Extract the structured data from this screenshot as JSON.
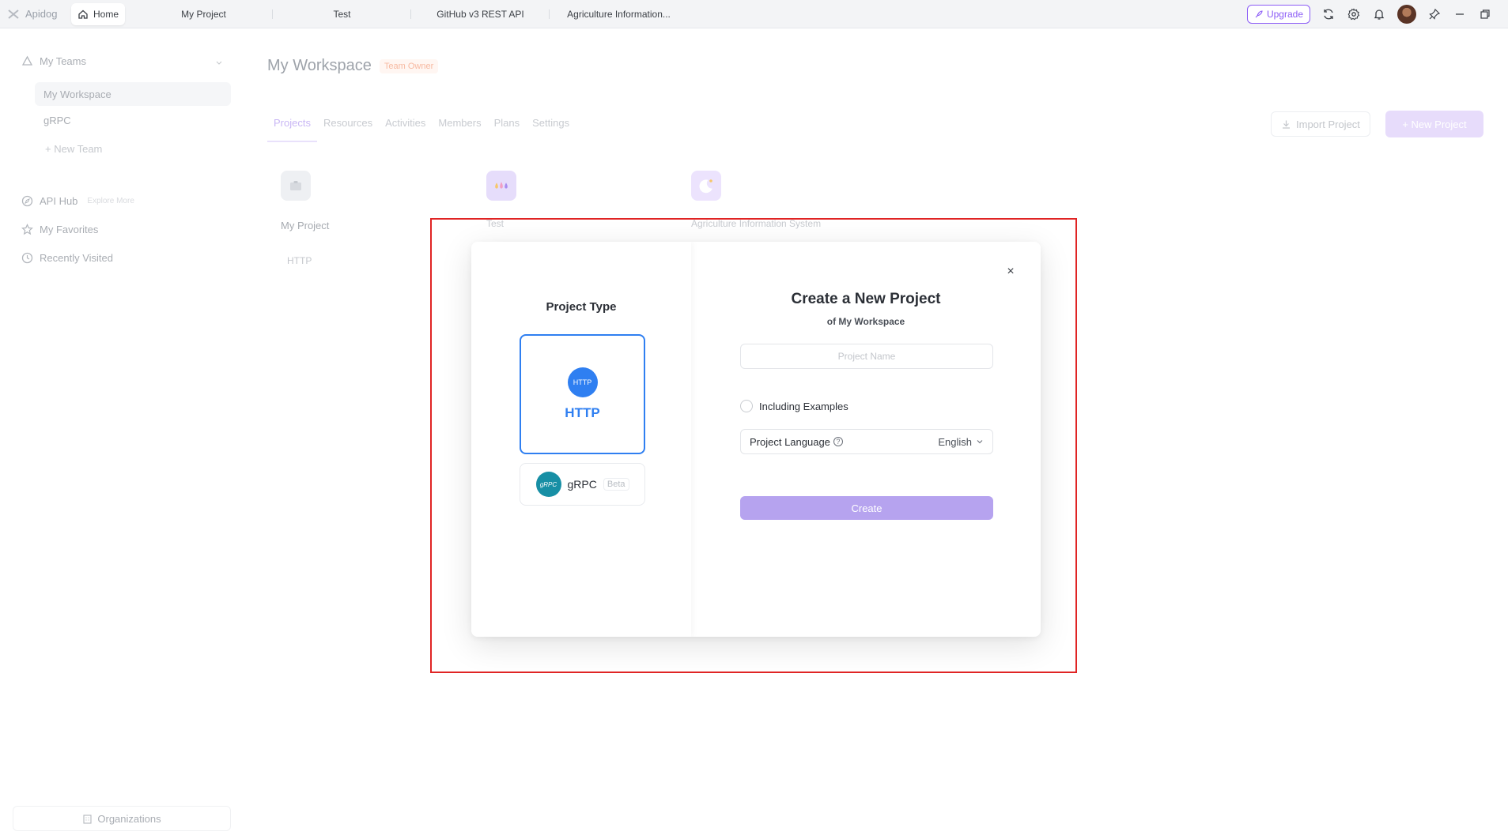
{
  "app": {
    "name": "Apidog"
  },
  "topbar": {
    "tabs": [
      {
        "label": "Home"
      },
      {
        "label": "My Project"
      },
      {
        "label": "Test"
      },
      {
        "label": "GitHub v3 REST API"
      },
      {
        "label": "Agriculture Information..."
      }
    ],
    "upgrade_label": "Upgrade",
    "icons": [
      "refresh-icon",
      "settings-icon",
      "bell-icon",
      "avatar",
      "pin-icon",
      "minimize-icon",
      "restore-icon"
    ]
  },
  "sidebar": {
    "teams_label": "My Teams",
    "team_items": [
      "My Workspace",
      "gRPC"
    ],
    "new_team_label": "+ New Team",
    "api_hub_label": "API Hub",
    "explore_label": "Explore More",
    "favorites_label": "My Favorites",
    "recent_label": "Recently Visited",
    "organizations_label": "Organizations"
  },
  "main": {
    "title": "My Workspace",
    "owner_badge": "Team Owner",
    "tabs": [
      "Projects",
      "Resources",
      "Activities",
      "Members",
      "Plans",
      "Settings"
    ],
    "active_tab": "Projects",
    "import_label": "Import Project",
    "new_project_label": "+ New Project",
    "projects": [
      {
        "name": "My Project",
        "type": "HTTP"
      },
      {
        "name": "Test",
        "type": ""
      },
      {
        "name": "Agriculture Information System",
        "type": ""
      }
    ]
  },
  "modal": {
    "project_type_title": "Project Type",
    "http_label": "HTTP",
    "http_icon_text": "HTTP",
    "grpc_label": "gRPC",
    "grpc_icon_text": "gRPC",
    "beta_label": "Beta",
    "title": "Create a New Project",
    "subtitle": "of My Workspace",
    "name_placeholder": "Project Name",
    "name_value": "",
    "including_examples_label": "Including Examples",
    "including_examples_checked": false,
    "language_label": "Project Language",
    "language_value": "English",
    "create_label": "Create",
    "close_label": "×"
  },
  "colors": {
    "accent": "#2f7ff1",
    "create_button": "#b6a3ef",
    "upgrade": "#8b5cf6",
    "highlight_box": "#e02424"
  }
}
